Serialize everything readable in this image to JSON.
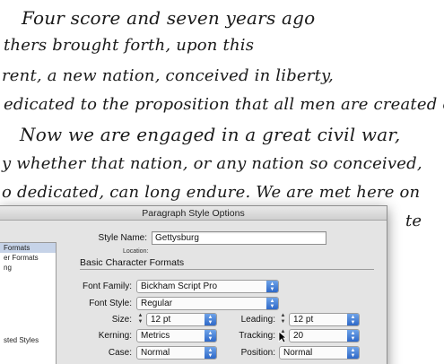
{
  "document": {
    "lines": [
      "Four score and seven years ago",
      "thers brought forth, upon this",
      "rent, a new nation, conceived in liberty,",
      "edicated to the proposition that all men are created equal.",
      "Now we are engaged in a great civil war,",
      "y whether that nation, or any nation so conceived,",
      "o dedicated, can long endure. We are met here on",
      "te"
    ]
  },
  "dialog": {
    "title": "Paragraph Style Options",
    "sidebar": {
      "items": [
        "Formats",
        "er Formats",
        "ng"
      ],
      "lower_item": "sted Styles"
    },
    "style_name_label": "Style Name:",
    "style_name_value": "Gettysburg",
    "location_label": "Location:",
    "section_title": "Basic Character Formats",
    "font_family_label": "Font Family:",
    "font_family_value": "Bickham Script Pro",
    "font_style_label": "Font Style:",
    "font_style_value": "Regular",
    "size_label": "Size:",
    "size_value": "12 pt",
    "leading_label": "Leading:",
    "leading_value": "12 pt",
    "kerning_label": "Kerning:",
    "kerning_value": "Metrics",
    "tracking_label": "Tracking:",
    "tracking_value": "20",
    "case_label": "Case:",
    "case_value": "Normal",
    "position_label": "Position:",
    "position_value": "Normal"
  },
  "colors": {
    "accent": "#3b74d0",
    "sidebar_selection": "#c6d3e8"
  }
}
